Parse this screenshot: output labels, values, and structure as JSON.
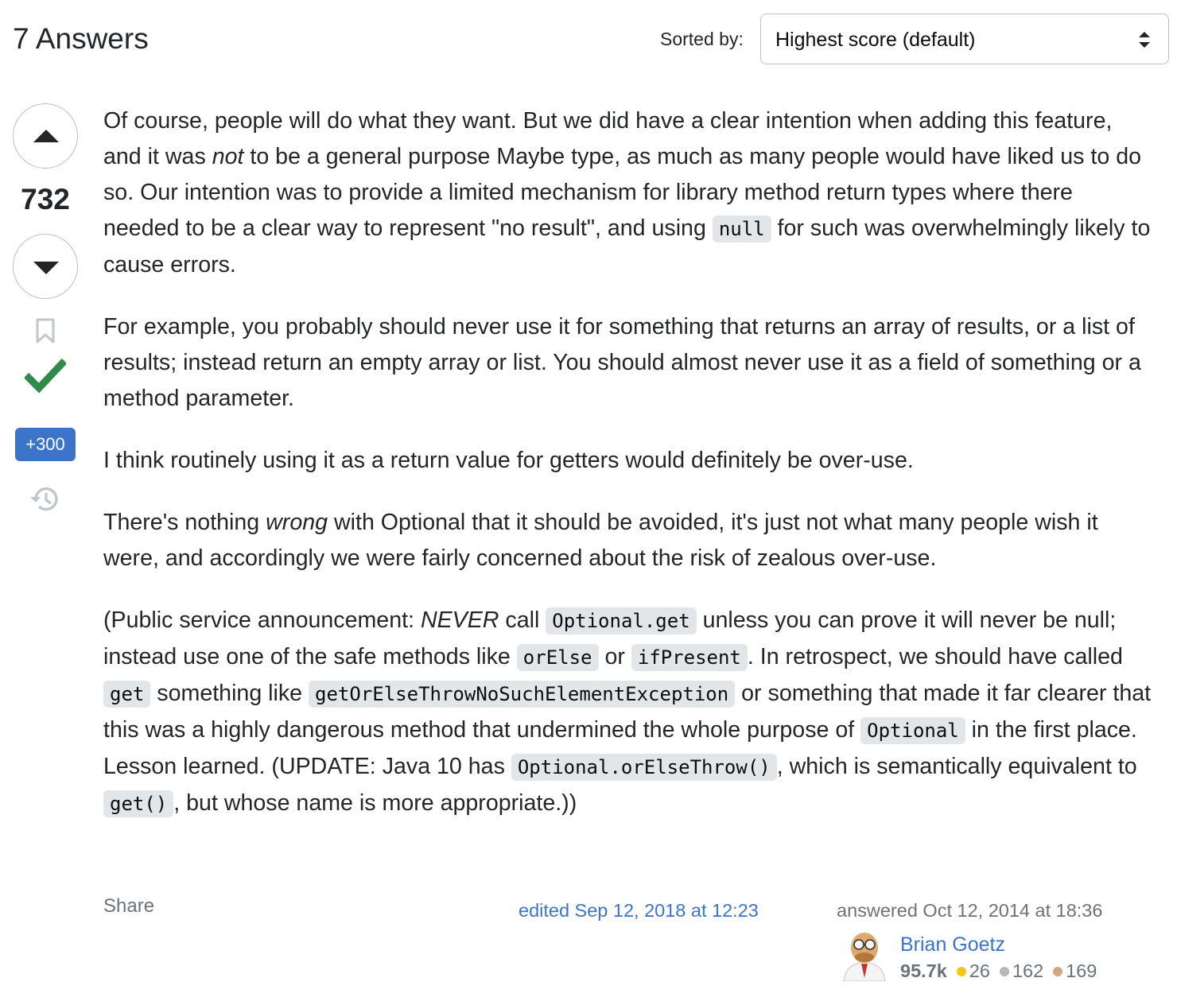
{
  "header": {
    "answers_count": "7 Answers",
    "sort_label": "Sorted by:",
    "sort_value": "Highest score (default)"
  },
  "vote": {
    "score": "732",
    "bounty": "+300"
  },
  "answer": {
    "p1": {
      "a": "Of course, people will do what they want. But we did have a clear intention when adding this feature, and it was ",
      "em": "not",
      "b": " to be a general purpose Maybe type, as much as many people would have liked us to do so. Our intention was to provide a limited mechanism for library method return types where there needed to be a clear way to represent \"no result\", and using ",
      "code": "null",
      "c": " for such was overwhelmingly likely to cause errors."
    },
    "p2": "For example, you probably should never use it for something that returns an array of results, or a list of results; instead return an empty array or list. You should almost never use it as a field of something or a method parameter.",
    "p3": "I think routinely using it as a return value for getters would definitely be over-use.",
    "p4": {
      "a": "There's nothing ",
      "em": "wrong",
      "b": " with Optional that it should be avoided, it's just not what many people wish it were, and accordingly we were fairly concerned about the risk of zealous over-use."
    },
    "p5": {
      "a": "(Public service announcement: ",
      "em": "NEVER",
      "b": " call ",
      "code1": "Optional.get",
      "c": " unless you can prove it will never be null; instead use one of the safe methods like ",
      "code2": "orElse",
      "d": " or ",
      "code3": "ifPresent",
      "e": ". In retrospect, we should have called ",
      "code4": "get",
      "f": " something like ",
      "code5": "getOrElseThrowNoSuchElementException",
      "g": " or something that made it far clearer that this was a highly dangerous method that undermined the whole purpose of ",
      "code6": "Optional",
      "h": " in the first place. Lesson learned. (UPDATE: Java 10 has ",
      "code7": "Optional.orElseThrow()",
      "i": ", which is semantically equivalent to ",
      "code8": "get()",
      "j": ", but whose name is more appropriate.))"
    }
  },
  "footer": {
    "share": "Share",
    "edited": "edited Sep 12, 2018 at 12:23",
    "answered": "answered Oct 12, 2014 at 18:36",
    "user_name": "Brian Goetz",
    "reputation": "95.7k",
    "gold": "26",
    "silver": "162",
    "bronze": "169"
  },
  "icons": {
    "vote_up": "arrow-up-icon",
    "vote_down": "arrow-down-icon",
    "bookmark": "bookmark-icon",
    "accepted": "checkmark-icon",
    "history": "history-icon",
    "sort": "sort-arrows-icon"
  },
  "colors": {
    "accepted": "#2f8a4c",
    "link": "#3b74c8",
    "bounty_bg": "#3b74c8",
    "gold": "#f5c518",
    "silver": "#b4b8bc",
    "bronze": "#d1a684"
  }
}
